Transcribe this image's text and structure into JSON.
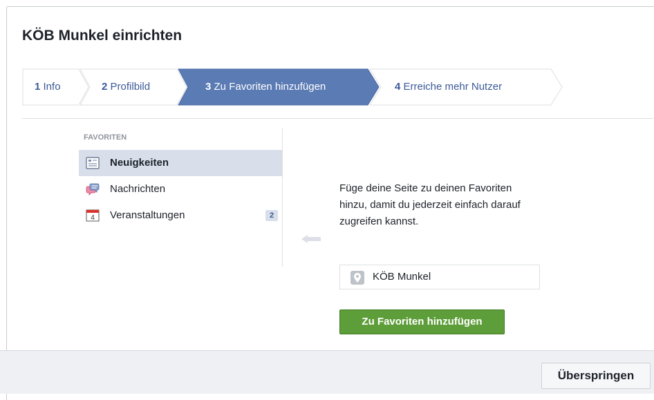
{
  "dialog": {
    "title": "KÖB Munkel einrichten"
  },
  "steps": [
    {
      "num": "1",
      "label": "Info",
      "active": false
    },
    {
      "num": "2",
      "label": "Profilbild",
      "active": false
    },
    {
      "num": "3",
      "label": "Zu Favoriten hinzufügen",
      "active": true
    },
    {
      "num": "4",
      "label": "Erreiche mehr Nutzer",
      "active": false
    }
  ],
  "favorites": {
    "header": "FAVORITEN",
    "items": [
      {
        "label": "Neuigkeiten",
        "icon": "news-feed-icon",
        "selected": true
      },
      {
        "label": "Nachrichten",
        "icon": "messages-icon",
        "selected": false
      },
      {
        "label": "Veranstaltungen",
        "icon": "calendar-icon",
        "selected": false,
        "badge": "2",
        "calendar_day": "4"
      }
    ]
  },
  "panel": {
    "description": "Füge deine Seite zu deinen Favoriten hinzu, damit du jederzeit einfach darauf zugreifen kannst.",
    "page_name": "KÖB Munkel",
    "add_button": "Zu Favoriten hinzufügen"
  },
  "footer": {
    "skip_button": "Überspringen"
  },
  "colors": {
    "step_active": "#5b7bb4",
    "add_button": "#5e9e3a",
    "link": "#3b5998"
  }
}
